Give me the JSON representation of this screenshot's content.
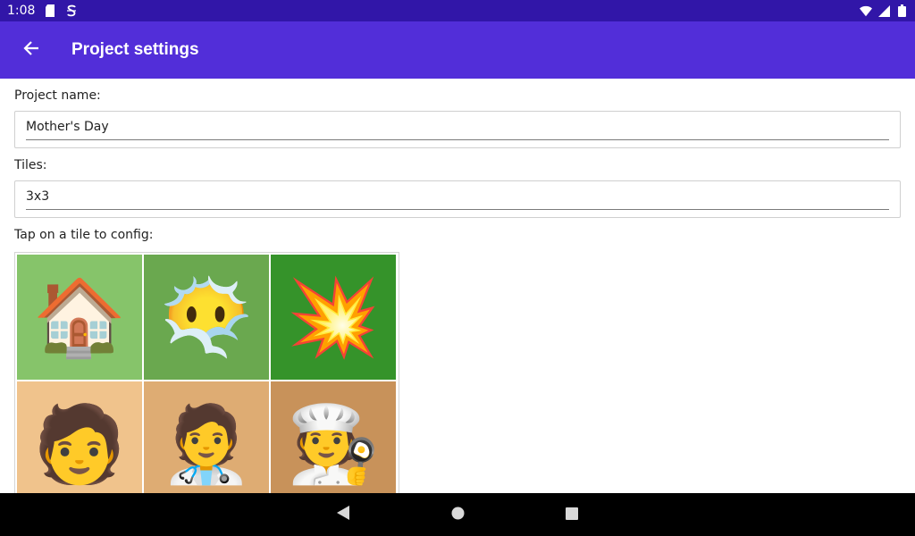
{
  "status_bar": {
    "time": "1:08",
    "icons": [
      "sd-card-icon",
      "s-app-icon",
      "wifi-icon",
      "signal-icon",
      "battery-icon"
    ]
  },
  "app_bar": {
    "title": "Project settings",
    "back_icon": "arrow-left-icon"
  },
  "form": {
    "project_name_label": "Project name:",
    "project_name_value": "Mother's Day",
    "tiles_label": "Tiles:",
    "tiles_value": "3x3",
    "tap_hint": "Tap on a tile to config:"
  },
  "tiles": [
    {
      "emoji": "🏠",
      "name": "house",
      "bg": "#86c46a"
    },
    {
      "emoji": "😶‍🌫️",
      "name": "face-in-clouds",
      "bg": "#6aa84f"
    },
    {
      "emoji": "💥",
      "name": "collision",
      "bg": "#35932a"
    },
    {
      "emoji": "🧑",
      "name": "person",
      "bg": "#f0c38c"
    },
    {
      "emoji": "🧑‍⚕️",
      "name": "health-worker",
      "bg": "#deac73"
    },
    {
      "emoji": "🧑‍🍳",
      "name": "cook",
      "bg": "#c8925a"
    }
  ],
  "colors": {
    "status_bar": "#3116a8",
    "app_bar": "#522ed9",
    "nav_bar": "#000000"
  },
  "nav_bar": {
    "icons": [
      "back-triangle-icon",
      "home-circle-icon",
      "recents-square-icon"
    ]
  }
}
